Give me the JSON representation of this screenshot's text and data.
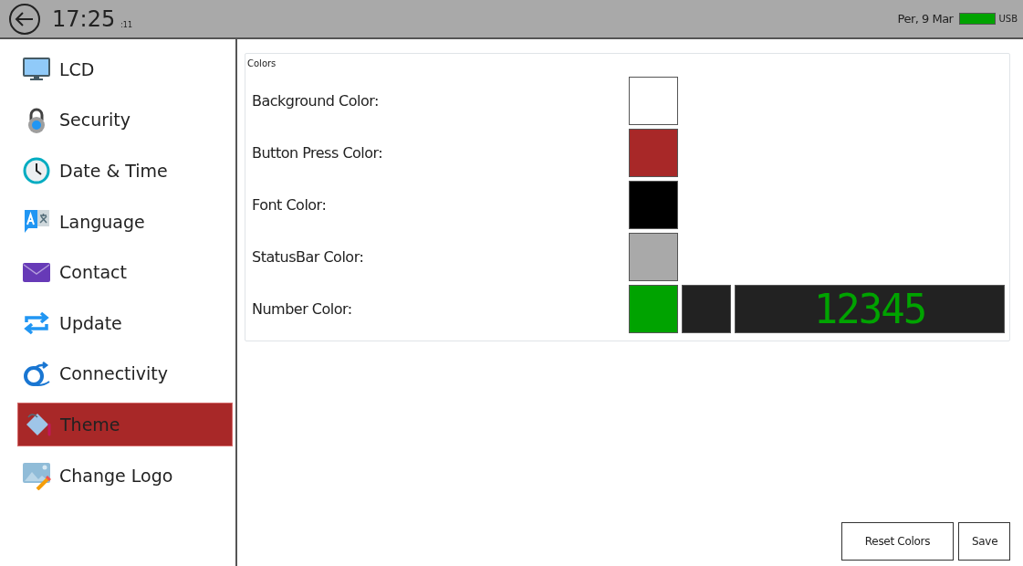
{
  "status_bar": {
    "time": "17:25",
    "seconds": ":11",
    "date": "Per, 9 Mar",
    "power": "USB"
  },
  "sidebar": {
    "items": [
      {
        "label": "LCD",
        "selected": false
      },
      {
        "label": "Security",
        "selected": false
      },
      {
        "label": "Date & Time",
        "selected": false
      },
      {
        "label": "Language",
        "selected": false
      },
      {
        "label": "Contact",
        "selected": false
      },
      {
        "label": "Update",
        "selected": false
      },
      {
        "label": "Connectivity",
        "selected": false
      },
      {
        "label": "Theme",
        "selected": true
      },
      {
        "label": "Change Logo",
        "selected": false
      }
    ]
  },
  "colors_panel": {
    "title": "Colors",
    "rows": [
      {
        "kind": "swatch",
        "label": "Background Color:",
        "swatches": [
          {
            "color": "#ffffff"
          }
        ]
      },
      {
        "kind": "swatch",
        "label": "Button Press Color:",
        "swatches": [
          {
            "color": "#a82828"
          }
        ]
      },
      {
        "kind": "swatch",
        "label": "Font Color:",
        "swatches": [
          {
            "color": "#000000"
          }
        ]
      },
      {
        "kind": "swatch",
        "label": "StatusBar Color:",
        "swatches": [
          {
            "color": "#a9a9a9"
          }
        ]
      },
      {
        "kind": "number",
        "label": "Number Color:",
        "swatches": [
          {
            "color": "#00a300"
          },
          {
            "color": "#222222"
          }
        ],
        "preview": "12345"
      }
    ]
  },
  "buttons": [
    "Reset Colors",
    "Save"
  ]
}
